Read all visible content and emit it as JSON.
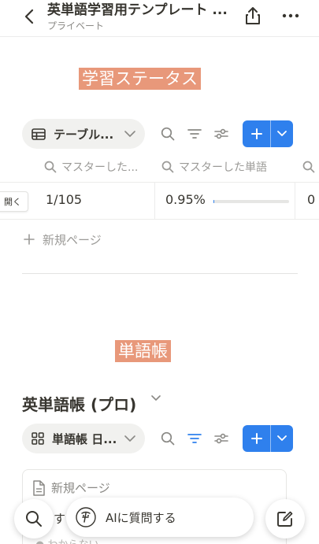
{
  "header": {
    "title": "英単語学習用テンプレート ...",
    "subtitle": "プライベート"
  },
  "section1": {
    "heading": "学習ステータス",
    "view_label": "テーブル...",
    "columns": [
      {
        "label": "マスターした..."
      },
      {
        "label": "マスターした単語"
      }
    ],
    "row": {
      "open_label": "開く",
      "count": "1/105",
      "percent": "0.95%",
      "progress": 0.0095,
      "next_cell": "0"
    },
    "new_page_label": "新規ページ"
  },
  "section2": {
    "heading": "単語帳",
    "db_title": "英単語帳 (プロ)",
    "view_label": "単語帳 日...",
    "card_new_page": "新規ページ",
    "card_tag": "● わからない",
    "peek_text": "す"
  },
  "bottom": {
    "ai_label": "AIに質問する"
  },
  "colors": {
    "accent": "#2f80ed",
    "heading_bg": "#e8987a"
  }
}
